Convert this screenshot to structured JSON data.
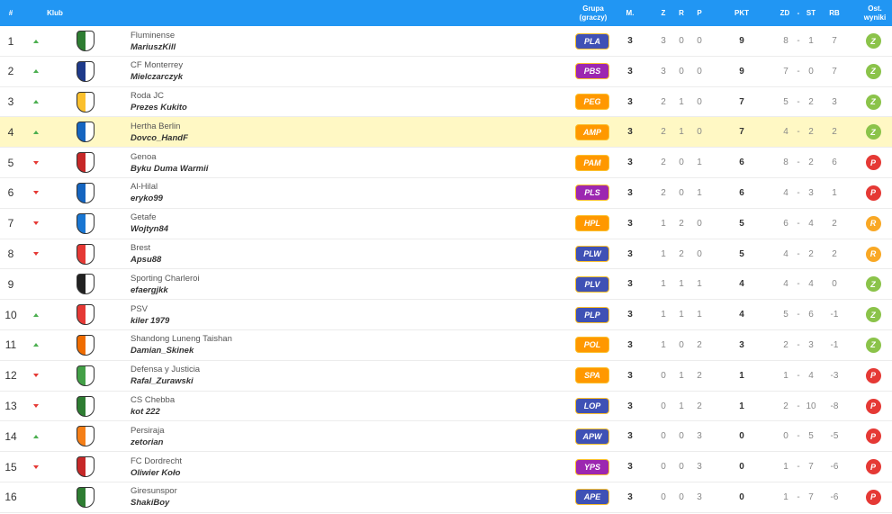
{
  "header": {
    "pos": "#",
    "club": "Klub",
    "group": "Grupa (graczy)",
    "m": "M.",
    "z": "Z",
    "r": "R",
    "p": "P",
    "pkt": "PKT",
    "zd": "ZD",
    "dash": "-",
    "st": "ST",
    "rb": "RB",
    "last": "Ost. wyniki"
  },
  "colors": {
    "header_bg": "#2196f3",
    "highlight": "#fff8c4",
    "win": "#8bc34a",
    "loss": "#e53935",
    "draw": "#f9a825",
    "badge_blue": "#3f51b5",
    "badge_purple": "#9c27b0",
    "badge_orange": "#ff9800"
  },
  "rows": [
    {
      "pos": "1",
      "trend": "up",
      "team": "Fluminense",
      "manager": "MariuszKill",
      "group": "PLA",
      "badge_color": "#3f51b5",
      "m": "3",
      "z": "3",
      "r": "0",
      "p": "0",
      "pkt": "9",
      "zd": "8",
      "st": "1",
      "rb": "7",
      "result": "Z",
      "crest": "#2e7d32",
      "highlight": false
    },
    {
      "pos": "2",
      "trend": "up",
      "team": "CF Monterrey",
      "manager": "Mielczarczyk",
      "group": "PBS",
      "badge_color": "#9c27b0",
      "m": "3",
      "z": "3",
      "r": "0",
      "p": "0",
      "pkt": "9",
      "zd": "7",
      "st": "0",
      "rb": "7",
      "result": "Z",
      "crest": "#1e3a8a",
      "highlight": false
    },
    {
      "pos": "3",
      "trend": "up",
      "team": "Roda JC",
      "manager": "Prezes Kukito",
      "group": "PEG",
      "badge_color": "#ff9800",
      "m": "3",
      "z": "2",
      "r": "1",
      "p": "0",
      "pkt": "7",
      "zd": "5",
      "st": "2",
      "rb": "3",
      "result": "Z",
      "crest": "#fbc02d",
      "highlight": false
    },
    {
      "pos": "4",
      "trend": "up",
      "team": "Hertha Berlin",
      "manager": "Dovco_HandF",
      "group": "AMP",
      "badge_color": "#ff9800",
      "m": "3",
      "z": "2",
      "r": "1",
      "p": "0",
      "pkt": "7",
      "zd": "4",
      "st": "2",
      "rb": "2",
      "result": "Z",
      "crest": "#1565c0",
      "highlight": true
    },
    {
      "pos": "5",
      "trend": "down",
      "team": "Genoa",
      "manager": "Byku Duma Warmii",
      "group": "PAM",
      "badge_color": "#ff9800",
      "m": "3",
      "z": "2",
      "r": "0",
      "p": "1",
      "pkt": "6",
      "zd": "8",
      "st": "2",
      "rb": "6",
      "result": "P",
      "crest": "#c62828",
      "highlight": false
    },
    {
      "pos": "6",
      "trend": "down",
      "team": "Al-Hilal",
      "manager": "eryko99",
      "group": "PLS",
      "badge_color": "#9c27b0",
      "m": "3",
      "z": "2",
      "r": "0",
      "p": "1",
      "pkt": "6",
      "zd": "4",
      "st": "3",
      "rb": "1",
      "result": "P",
      "crest": "#1565c0",
      "highlight": false
    },
    {
      "pos": "7",
      "trend": "down",
      "team": "Getafe",
      "manager": "Wojtyn84",
      "group": "HPL",
      "badge_color": "#ff9800",
      "m": "3",
      "z": "1",
      "r": "2",
      "p": "0",
      "pkt": "5",
      "zd": "6",
      "st": "4",
      "rb": "2",
      "result": "R",
      "crest": "#1976d2",
      "highlight": false
    },
    {
      "pos": "8",
      "trend": "down",
      "team": "Brest",
      "manager": "Apsu88",
      "group": "PLW",
      "badge_color": "#3f51b5",
      "m": "3",
      "z": "1",
      "r": "2",
      "p": "0",
      "pkt": "5",
      "zd": "4",
      "st": "2",
      "rb": "2",
      "result": "R",
      "crest": "#e53935",
      "highlight": false
    },
    {
      "pos": "9",
      "trend": "none",
      "team": "Sporting Charleroi",
      "manager": "efaergjkk",
      "group": "PLV",
      "badge_color": "#3f51b5",
      "m": "3",
      "z": "1",
      "r": "1",
      "p": "1",
      "pkt": "4",
      "zd": "4",
      "st": "4",
      "rb": "0",
      "result": "Z",
      "crest": "#212121",
      "highlight": false
    },
    {
      "pos": "10",
      "trend": "up",
      "team": "PSV",
      "manager": "kiler 1979",
      "group": "PLP",
      "badge_color": "#3f51b5",
      "m": "3",
      "z": "1",
      "r": "1",
      "p": "1",
      "pkt": "4",
      "zd": "5",
      "st": "6",
      "rb": "-1",
      "result": "Z",
      "crest": "#e53935",
      "highlight": false
    },
    {
      "pos": "11",
      "trend": "up",
      "team": "Shandong Luneng Taishan",
      "manager": "Damian_Skinek",
      "group": "POL",
      "badge_color": "#ff9800",
      "m": "3",
      "z": "1",
      "r": "0",
      "p": "2",
      "pkt": "3",
      "zd": "2",
      "st": "3",
      "rb": "-1",
      "result": "Z",
      "crest": "#ef6c00",
      "highlight": false
    },
    {
      "pos": "12",
      "trend": "down",
      "team": "Defensa y Justicia",
      "manager": "Rafal_Zurawski",
      "group": "SPA",
      "badge_color": "#ff9800",
      "m": "3",
      "z": "0",
      "r": "1",
      "p": "2",
      "pkt": "1",
      "zd": "1",
      "st": "4",
      "rb": "-3",
      "result": "P",
      "crest": "#43a047",
      "highlight": false
    },
    {
      "pos": "13",
      "trend": "down",
      "team": "CS Chebba",
      "manager": "kot 222",
      "group": "LOP",
      "badge_color": "#3f51b5",
      "m": "3",
      "z": "0",
      "r": "1",
      "p": "2",
      "pkt": "1",
      "zd": "2",
      "st": "10",
      "rb": "-8",
      "result": "P",
      "crest": "#2e7d32",
      "highlight": false
    },
    {
      "pos": "14",
      "trend": "up",
      "team": "Persiraja",
      "manager": "zetorian",
      "group": "APW",
      "badge_color": "#3f51b5",
      "m": "3",
      "z": "0",
      "r": "0",
      "p": "3",
      "pkt": "0",
      "zd": "0",
      "st": "5",
      "rb": "-5",
      "result": "P",
      "crest": "#f57f17",
      "highlight": false
    },
    {
      "pos": "15",
      "trend": "down",
      "team": "FC Dordrecht",
      "manager": "Oliwier Koło",
      "group": "YPS",
      "badge_color": "#9c27b0",
      "m": "3",
      "z": "0",
      "r": "0",
      "p": "3",
      "pkt": "0",
      "zd": "1",
      "st": "7",
      "rb": "-6",
      "result": "P",
      "crest": "#c62828",
      "highlight": false
    },
    {
      "pos": "16",
      "trend": "none",
      "team": "Giresunspor",
      "manager": "ShakiBoy",
      "group": "APE",
      "badge_color": "#3f51b5",
      "m": "3",
      "z": "0",
      "r": "0",
      "p": "3",
      "pkt": "0",
      "zd": "1",
      "st": "7",
      "rb": "-6",
      "result": "P",
      "crest": "#2e7d32",
      "highlight": false
    }
  ]
}
